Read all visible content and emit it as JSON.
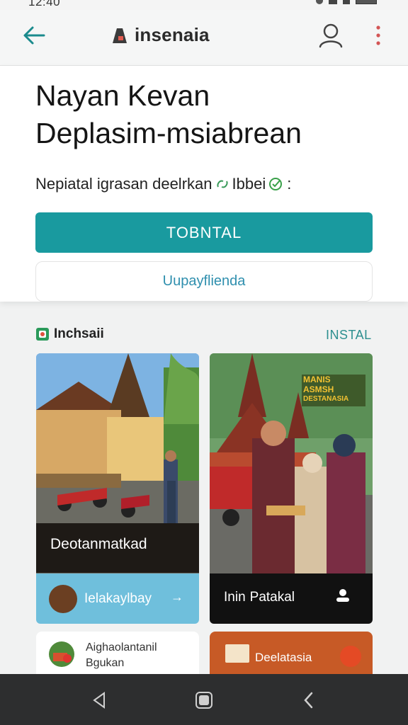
{
  "status_bar": {
    "time": "12:40"
  },
  "app_bar": {
    "title": "insenaia"
  },
  "hero": {
    "title_line1": "Nayan Kevan",
    "title_line2": "Deplasim-msiabrean",
    "subtitle": "Nepiatal igrasan deelrkan",
    "subtitle_suffix": "Ibbei",
    "primary_button": "TOBNTAL",
    "secondary_button": "Uupayflienda"
  },
  "section": {
    "label": "Inchsaii",
    "action": "INSTAL"
  },
  "cards": [
    {
      "caption": "Deotanmatkad",
      "footer": "Ielakaylbay",
      "footer_arrow": "→"
    },
    {
      "poster_line1": "MANIS",
      "poster_line2": "ASMSH",
      "poster_line3": "DESTANASIA",
      "footer": "Patakal",
      "footer_prefix": "Inin"
    }
  ],
  "mini_cards": [
    {
      "line1": "Aighaolantanil",
      "line2": "Bgukan"
    },
    {
      "text": "Deelatasia"
    }
  ],
  "colors": {
    "primary": "#199a9f",
    "link": "#2f8fae",
    "card_footer_blue": "#6fbfdc",
    "card_footer_dark": "#111111",
    "mini_orange": "#c75a26",
    "nav_bar": "#2d2e2f"
  },
  "icons": {
    "back": "arrow-left-icon",
    "profile": "user-icon",
    "more": "more-vert-icon",
    "section": "app-icon",
    "nav_back": "triangle-back-icon",
    "nav_home": "square-home-icon",
    "nav_recent": "chevron-left-icon"
  }
}
